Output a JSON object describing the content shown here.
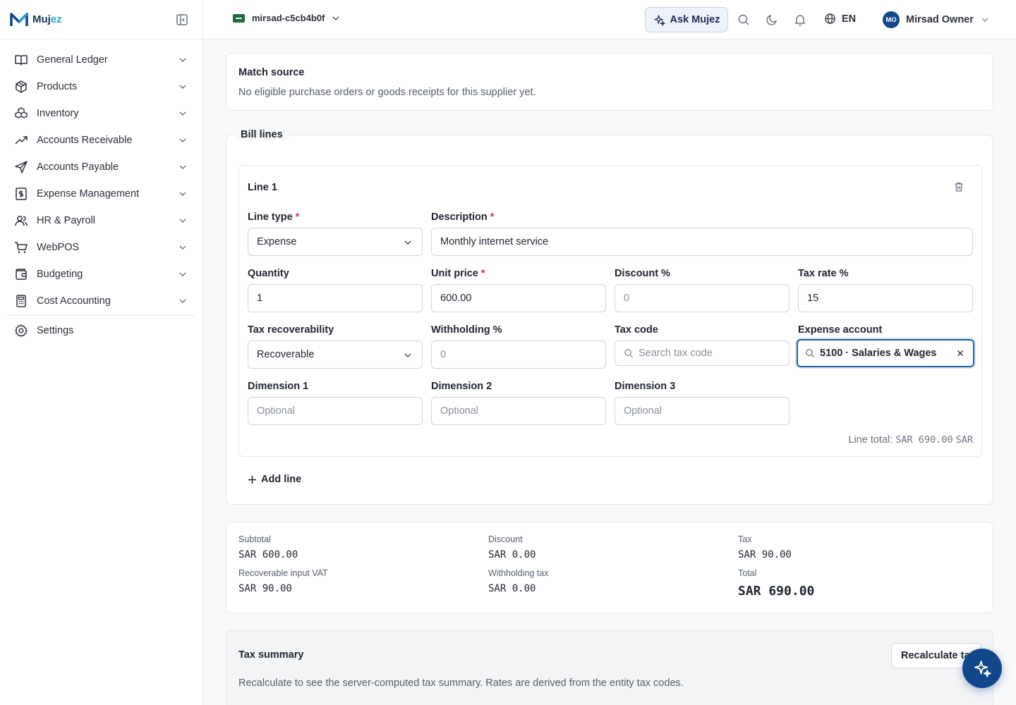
{
  "brand": {
    "name_a": "Muj",
    "name_b": "ez"
  },
  "sidebar": {
    "items": [
      {
        "label": "General Ledger",
        "icon": "book-open-icon"
      },
      {
        "label": "Products",
        "icon": "package-icon"
      },
      {
        "label": "Inventory",
        "icon": "boxes-icon"
      },
      {
        "label": "Accounts Receivable",
        "icon": "trending-up-icon"
      },
      {
        "label": "Accounts Payable",
        "icon": "send-icon"
      },
      {
        "label": "Expense Management",
        "icon": "receipt-dollar-icon"
      },
      {
        "label": "HR & Payroll",
        "icon": "users-icon"
      },
      {
        "label": "WebPOS",
        "icon": "shopping-cart-icon"
      },
      {
        "label": "Budgeting",
        "icon": "wallet-icon"
      },
      {
        "label": "Cost Accounting",
        "icon": "calculator-icon"
      }
    ],
    "settings_label": "Settings"
  },
  "topbar": {
    "org_name": "mirsad-c5cb4b0f",
    "ask_label": "Ask Mujez",
    "lang": "EN",
    "avatar_initials": "MO",
    "user_name": "Mirsad Owner"
  },
  "match_source": {
    "title": "Match source",
    "message": "No eligible purchase orders or goods receipts for this supplier yet."
  },
  "bill_lines": {
    "legend": "Bill lines",
    "line": {
      "title": "Line 1",
      "labels": {
        "line_type": "Line type",
        "description": "Description",
        "quantity": "Quantity",
        "unit_price": "Unit price",
        "discount": "Discount %",
        "tax_rate": "Tax rate %",
        "tax_recoverability": "Tax recoverability",
        "withholding": "Withholding %",
        "tax_code": "Tax code",
        "expense_account": "Expense account",
        "dimension1": "Dimension 1",
        "dimension2": "Dimension 2",
        "dimension3": "Dimension 3"
      },
      "required_mark": "*",
      "values": {
        "line_type": "Expense",
        "description": "Monthly internet service",
        "quantity": "1",
        "unit_price": "600.00",
        "discount": "0",
        "tax_rate": "15",
        "tax_recoverability": "Recoverable",
        "withholding": "0",
        "tax_code_placeholder": "Search tax code",
        "expense_account": "5100 · Salaries & Wages",
        "dimension_placeholder": "Optional"
      },
      "line_total_label": "Line total:",
      "line_total_value": "SAR 690.00",
      "line_total_currency": "SAR"
    },
    "add_line_label": "Add line"
  },
  "totals": {
    "subtotal_label": "Subtotal",
    "subtotal": "SAR 600.00",
    "discount_label": "Discount",
    "discount": "SAR 0.00",
    "tax_label": "Tax",
    "tax": "SAR 90.00",
    "recoverable_label": "Recoverable input VAT",
    "recoverable": "SAR 90.00",
    "withholding_label": "Withholding tax",
    "withholding": "SAR 0.00",
    "total_label": "Total",
    "total": "SAR 690.00"
  },
  "tax_summary": {
    "title": "Tax summary",
    "recalc_label": "Recalculate tax",
    "message": "Recalculate to see the server-computed tax summary. Rates are derived from the entity tax codes."
  },
  "colors": {
    "brand": "#12488a",
    "accent": "#2aa0d8",
    "required": "#d9333a"
  }
}
